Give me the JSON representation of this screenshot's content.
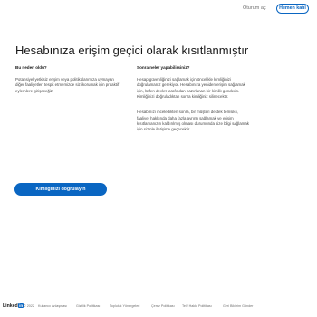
{
  "header": {
    "signin_label": "Oturum aç",
    "join_label": "Hemen katıl"
  },
  "main": {
    "title": "Hesabınıza erişim geçici olarak kısıtlanmıştır",
    "left_heading": "Bu neden oldu?",
    "left_text": "Potansiyel yetkisiz erişim veya politikalarımıza uymayan diğer faaliyetleri tespit etmemizde sizi korumak için proaktif eylemlere girişeceğiz.",
    "right_heading": "Sonra neler yapabilirsiniz?",
    "right_text_1": "Hesap güvenliğinizi sağlamak için öncelikle kimliğinizi doğrulamanız gerekiyor. Hesabınıza yeniden erişim sağlamak için, lütfen devlet tarafından hazırlanan bir kimlik gönderin. Kimliğinizi doğruladıktan sonra kimliğiniz silinecektir.",
    "right_text_2": "Hesabınızı inceledikten sonra, bir müşteri destek temsilci, faaliyet hakkında daha fazla ayrıntı sağlamak ve erişim kısıtlamanızın kaldırılmış olması durumunda size bilgi sağlamak için sizinle iletişime geçecektir.",
    "verify_button_label": "Kimliğinizi doğrulayın"
  },
  "footer": {
    "logo_text": "Linked",
    "logo_in": "in",
    "copyright": "© 2022",
    "links": [
      "Kullanıcı Anlaşması",
      "Gizlilik Politikası",
      "Topluluk Yönergeleri",
      "Çerez Politikası",
      "Telif Hakkı Politikası",
      "Geri Bildirim Gönder"
    ]
  },
  "colors": {
    "brand": "#0a66c2",
    "background": "#ffffff"
  }
}
